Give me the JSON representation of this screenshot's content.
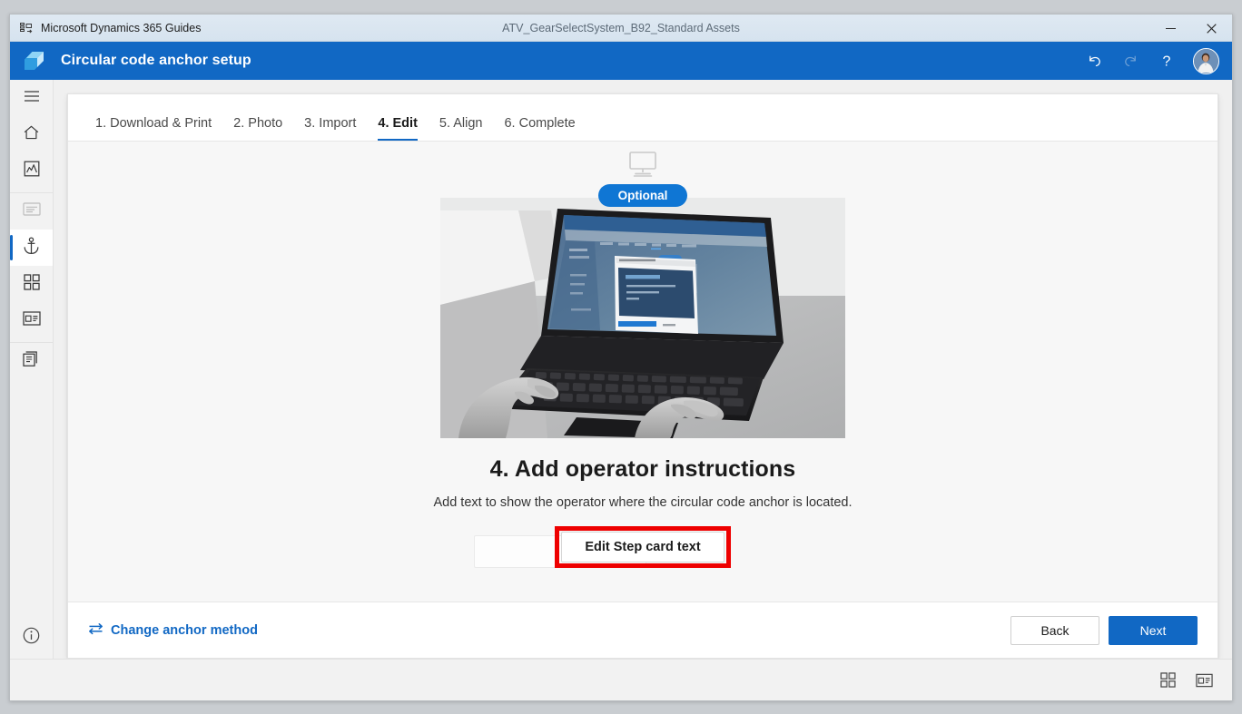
{
  "window": {
    "app_name": "Microsoft Dynamics 365 Guides",
    "document_title": "ATV_GearSelectSystem_B92_Standard Assets",
    "app_icon": "guides-app-icon",
    "controls": {
      "minimize": "minimize-icon",
      "close": "close-icon"
    }
  },
  "header": {
    "logo": "dynamics-guides-logo",
    "title": "Circular code anchor setup",
    "actions": [
      {
        "name": "undo-icon",
        "label": "Undo",
        "enabled": true
      },
      {
        "name": "redo-icon",
        "label": "Redo",
        "enabled": false
      },
      {
        "name": "help-icon",
        "label": "Help",
        "enabled": true
      }
    ],
    "avatar": "user-avatar"
  },
  "sidebar": {
    "items": [
      {
        "name": "menu-icon",
        "label": "Menu",
        "state": "normal"
      },
      {
        "name": "home-icon",
        "label": "Home",
        "state": "normal"
      },
      {
        "name": "analytics-icon",
        "label": "Analytics",
        "state": "normal"
      },
      {
        "name": "step-card-icon",
        "label": "Step card",
        "state": "disabled"
      },
      {
        "name": "anchor-icon",
        "label": "Anchor",
        "state": "selected"
      },
      {
        "name": "apps-grid-icon",
        "label": "3D parts",
        "state": "normal"
      },
      {
        "name": "media-card-icon",
        "label": "Media",
        "state": "normal"
      },
      {
        "name": "duplicate-icon",
        "label": "Copy",
        "state": "normal"
      }
    ],
    "bottom_item": {
      "name": "info-icon",
      "label": "Information"
    }
  },
  "tabs": [
    {
      "label": "1. Download & Print",
      "active": false
    },
    {
      "label": "2. Photo",
      "active": false
    },
    {
      "label": "3. Import",
      "active": false
    },
    {
      "label": "4. Edit",
      "active": true
    },
    {
      "label": "5. Align",
      "active": false
    },
    {
      "label": "6. Complete",
      "active": false
    }
  ],
  "stage": {
    "device_icon": "desktop-monitor-icon",
    "badge": "Optional",
    "image_alt": "Hands typing on a laptop showing the Guides PC app",
    "title": "4. Add operator instructions",
    "description": "Add text to show the operator where the circular code anchor is located.",
    "primary_action": "Edit Step card text",
    "highlight_color": "#ee0000"
  },
  "footer": {
    "change_method_icon": "swap-arrows-icon",
    "change_method_label": "Change anchor method",
    "back_label": "Back",
    "next_label": "Next"
  },
  "statusbar": {
    "icons": [
      {
        "name": "apps-grid-icon",
        "label": "Grid view"
      },
      {
        "name": "media-card-icon",
        "label": "Media panel"
      }
    ]
  },
  "colors": {
    "brand_blue": "#1168c4",
    "accent_blue": "#0f76d4",
    "annotation_red": "#ee0000",
    "titlebar": "#dfe9f2",
    "canvas": "#f0f0f0",
    "card": "#f7f7f7"
  }
}
